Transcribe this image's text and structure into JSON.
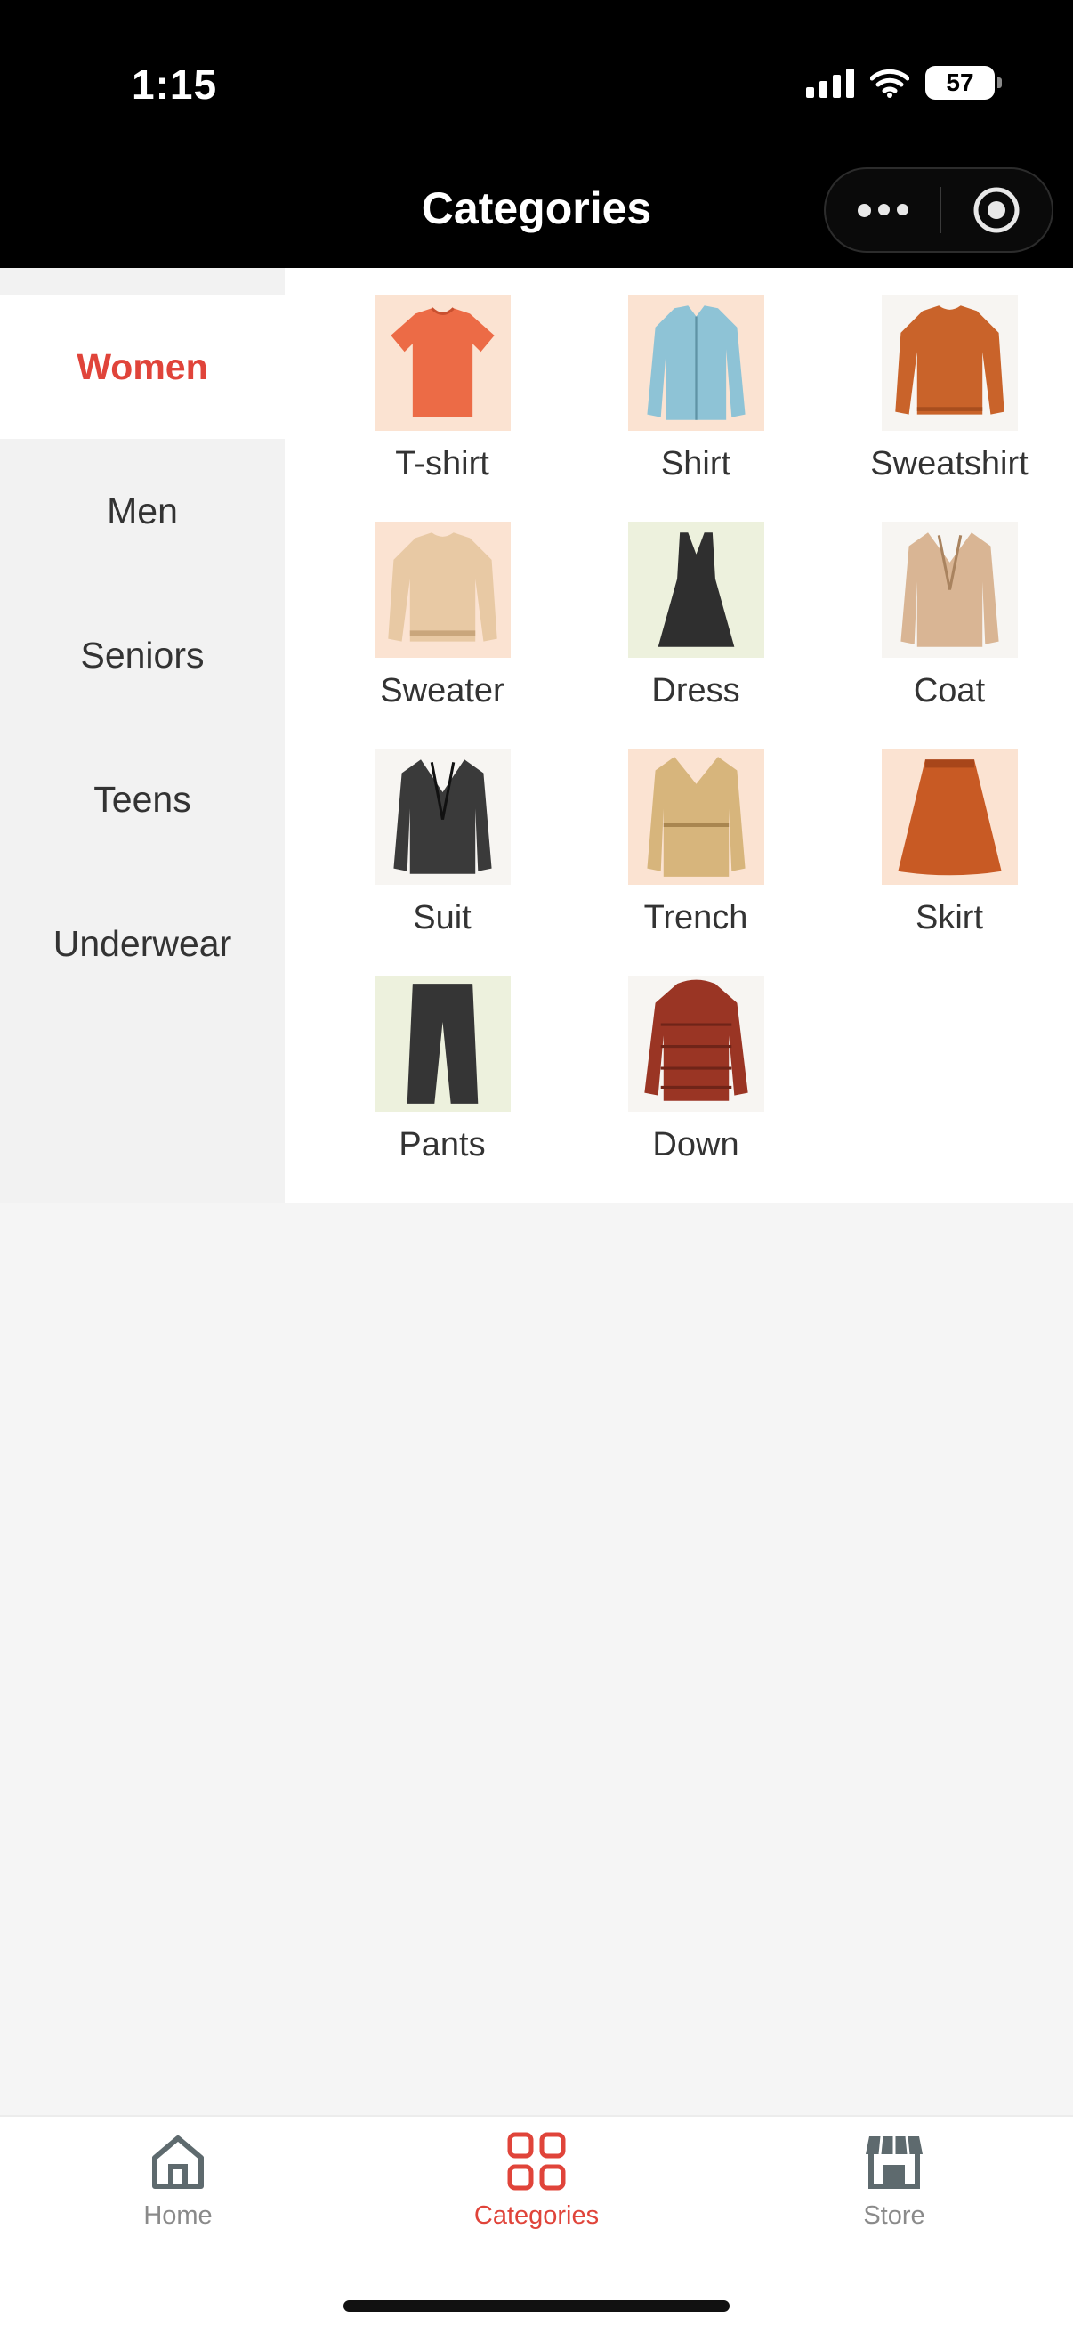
{
  "status_bar": {
    "time": "1:15",
    "battery": "57"
  },
  "nav": {
    "title": "Categories"
  },
  "sidebar": {
    "items": [
      {
        "label": "Women",
        "active": true
      },
      {
        "label": "Men",
        "active": false
      },
      {
        "label": "Seniors",
        "active": false
      },
      {
        "label": "Teens",
        "active": false
      },
      {
        "label": "Underwear",
        "active": false
      }
    ]
  },
  "categories": [
    {
      "label": "T-shirt",
      "icon": "tshirt-icon"
    },
    {
      "label": "Shirt",
      "icon": "shirt-icon"
    },
    {
      "label": "Sweatshirt",
      "icon": "sweatshirt-icon"
    },
    {
      "label": "Sweater",
      "icon": "sweater-icon"
    },
    {
      "label": "Dress",
      "icon": "dress-icon"
    },
    {
      "label": "Coat",
      "icon": "coat-icon"
    },
    {
      "label": "Suit",
      "icon": "suit-icon"
    },
    {
      "label": "Trench",
      "icon": "trench-icon"
    },
    {
      "label": "Skirt",
      "icon": "skirt-icon"
    },
    {
      "label": "Pants",
      "icon": "pants-icon"
    },
    {
      "label": "Down",
      "icon": "down-jacket-icon"
    }
  ],
  "tabbar": {
    "items": [
      {
        "label": "Home",
        "icon": "home-icon",
        "active": false
      },
      {
        "label": "Categories",
        "icon": "grid-icon",
        "active": true
      },
      {
        "label": "Store",
        "icon": "store-icon",
        "active": false
      }
    ]
  },
  "colors": {
    "accent": "#e0443a",
    "text": "#333333",
    "inactive": "#8a8a8a"
  }
}
